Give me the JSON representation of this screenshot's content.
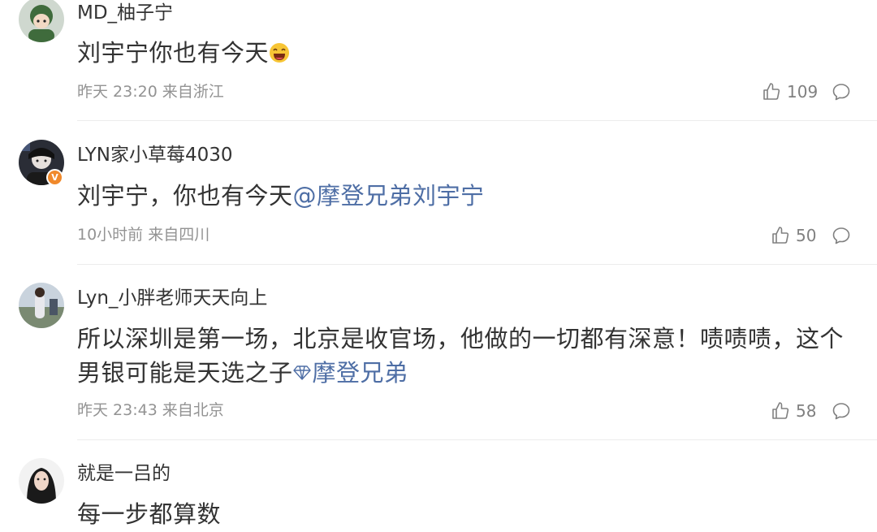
{
  "comments": [
    {
      "username": "MD_柚子宁",
      "text": "刘宇宁你也有今天",
      "time": "昨天 23:20",
      "location": "来自浙江",
      "likes": "109"
    },
    {
      "username": "LYN家小草莓4030",
      "text": "刘宇宁，你也有今天",
      "mention": "@摩登兄弟刘宇宁",
      "time": "10小时前",
      "location": "来自四川",
      "likes": "50",
      "verified_badge": "V"
    },
    {
      "username": "Lyn_小胖老师天天向上",
      "text": "所以深圳是第一场，北京是收官场，他做的一切都有深意！啧啧啧，这个男银可能是天选之子",
      "mention": "摩登兄弟",
      "time": "昨天 23:43",
      "location": "来自北京",
      "likes": "58"
    },
    {
      "username": "就是一吕的",
      "text": "每一步都算数"
    }
  ],
  "colors": {
    "text": "#333333",
    "meta": "#939393",
    "mention": "#4e6ea5",
    "badge": "#f0892b",
    "divider": "#ececec"
  },
  "icons": {
    "like": "thumbs-up-icon",
    "comment": "comment-bubble-icon",
    "emoji": "laughing-emoji-icon",
    "mention_prefix": "diamond-icon"
  }
}
